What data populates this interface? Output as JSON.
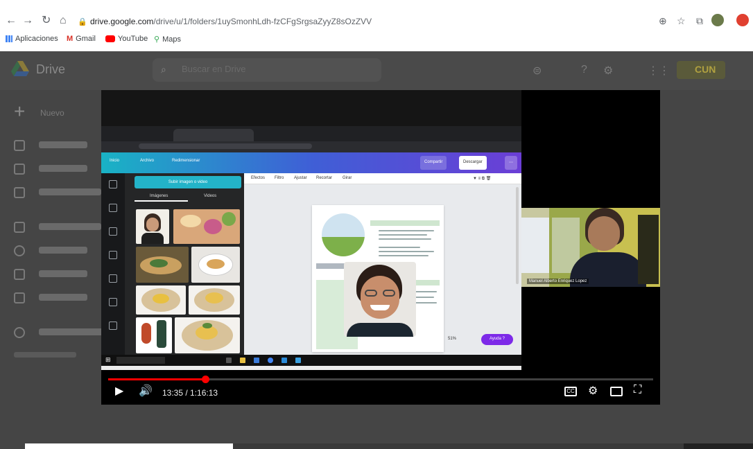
{
  "browser": {
    "url_host": "drive.google.com",
    "url_path": "/drive/u/1/folders/1uySmonhLdh-fzCFgSrgsaZyyZ8sOzZVV",
    "bookmarks": [
      {
        "label": "Aplicaciones",
        "icon": "apps-icon"
      },
      {
        "label": "Gmail",
        "icon": "gmail-icon"
      },
      {
        "label": "YouTube",
        "icon": "youtube-icon"
      },
      {
        "label": "Maps",
        "icon": "maps-icon"
      }
    ]
  },
  "drive": {
    "app_name": "Drive",
    "search_placeholder": "Buscar en Drive",
    "new_label": "Nuevo",
    "account_badge": "CUN"
  },
  "player": {
    "time_display": "13:35 / 1:16:13",
    "progress_fraction": 0.178,
    "accent_color": "#ff0000"
  },
  "inner_video": {
    "canva_topbar": {
      "home": "Inicio",
      "file": "Archivo",
      "resize": "Redimensionar",
      "share": "Compartir",
      "download": "Descargar"
    },
    "upload_label": "Subir imagen o video",
    "panel_tabs": [
      "Imágenes",
      "Videos"
    ],
    "editor_tools": [
      "Efectos",
      "Filtro",
      "Ajustar",
      "Recortar",
      "Girar"
    ],
    "help_label": "Ayuda ?",
    "zoom": "51%",
    "cam_name": "Manuel Alberto Enriquez Lopez"
  }
}
